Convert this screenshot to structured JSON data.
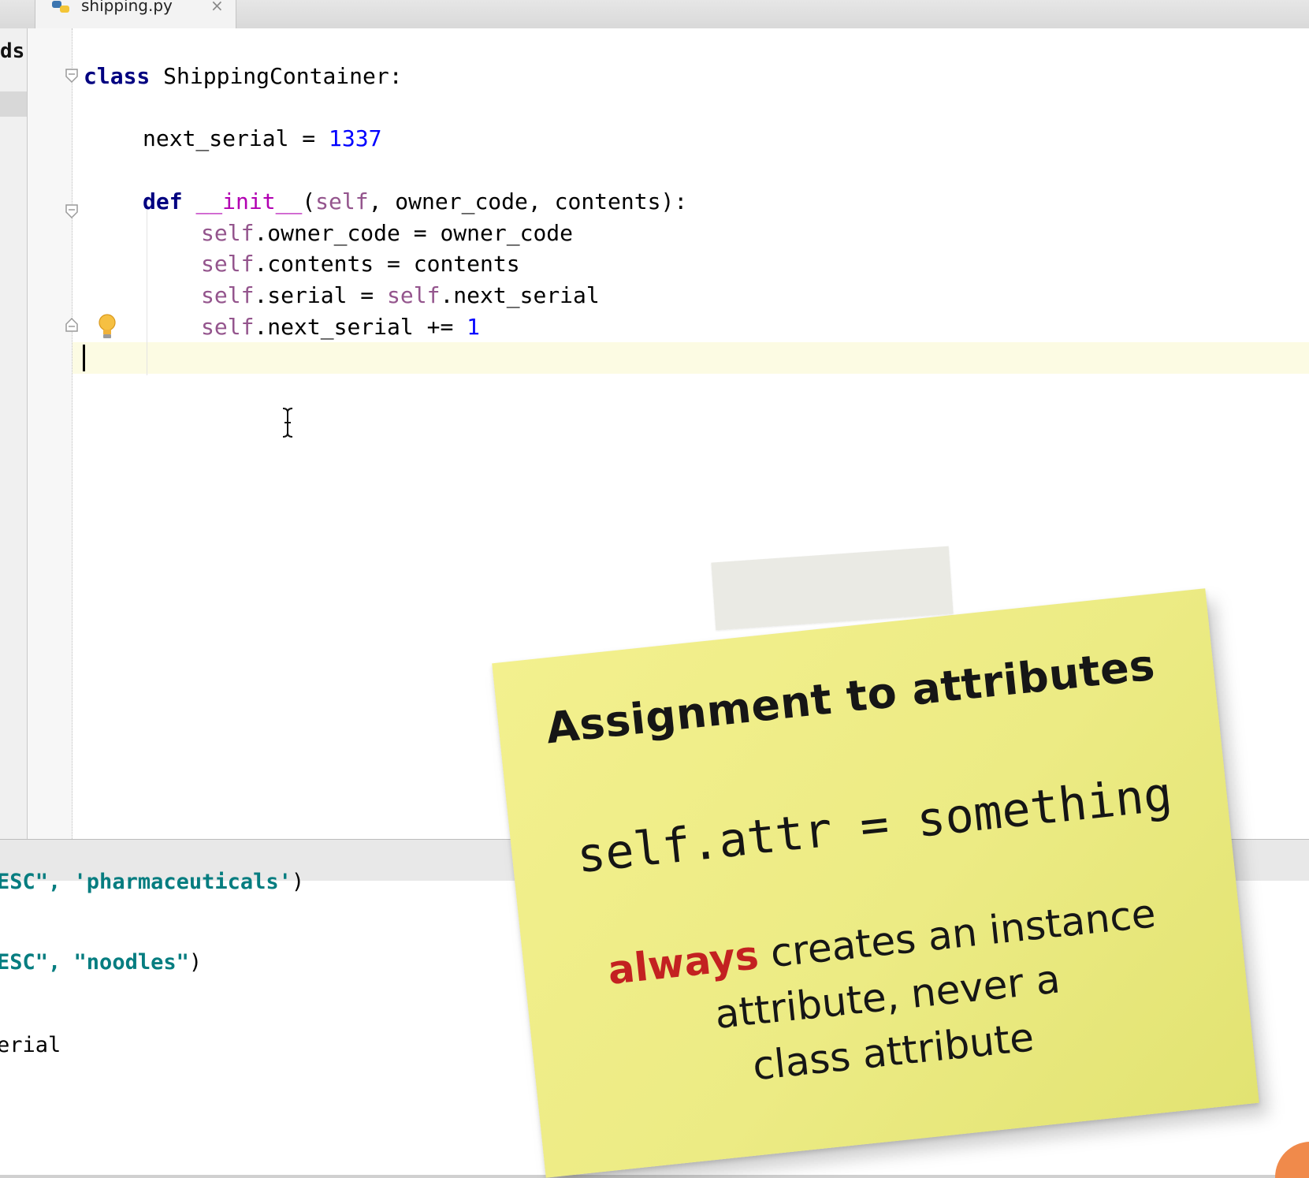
{
  "tab": {
    "filename": "shipping.py",
    "close_glyph": "×",
    "icon": "python-file-icon"
  },
  "project_panel": {
    "partial_label": "ds"
  },
  "editor": {
    "lines": {
      "l1": {
        "kw": "class",
        "rest": " ShippingContainer:"
      },
      "l2": {
        "name": "next_serial",
        "op": " = ",
        "num": "1337"
      },
      "l3": {
        "kw": "def",
        "sp": " ",
        "magic": "__init__",
        "open": "(",
        "self": "self",
        "rest": ", owner_code, contents):"
      },
      "l4": {
        "self": "self",
        "rest": ".owner_code = owner_code"
      },
      "l5": {
        "self": "self",
        "rest": ".contents = contents"
      },
      "l6": {
        "self": "self",
        "mid": ".serial = ",
        "self2": "self",
        "rest": ".next_serial"
      },
      "l7": {
        "self": "self",
        "rest": ".next_serial += ",
        "num": "1"
      }
    },
    "icons": [
      "fold-icon",
      "lightbulb-icon",
      "text-cursor-icon"
    ]
  },
  "console": {
    "line1": {
      "prefix": "ESC\", ",
      "string": "'pharmaceuticals'",
      "suffix": ")"
    },
    "line2": {
      "prefix": "ESC\", ",
      "string": "\"noodles\"",
      "suffix": ")"
    },
    "line3": {
      "text": "erial"
    }
  },
  "note": {
    "title": "Assignment to attributes",
    "code": "self.attr = something",
    "emphasis": "always",
    "body_line1": " creates an instance",
    "body_line2": "attribute, never a",
    "body_line3": "class attribute"
  },
  "colors": {
    "keyword": "#000080",
    "self": "#94558d",
    "magic": "#b200b2",
    "number": "#0000ff",
    "string": "#067d80",
    "note_background": "#eceb84",
    "note_emphasis": "#c32121",
    "caret_line": "#fcfbe3"
  }
}
